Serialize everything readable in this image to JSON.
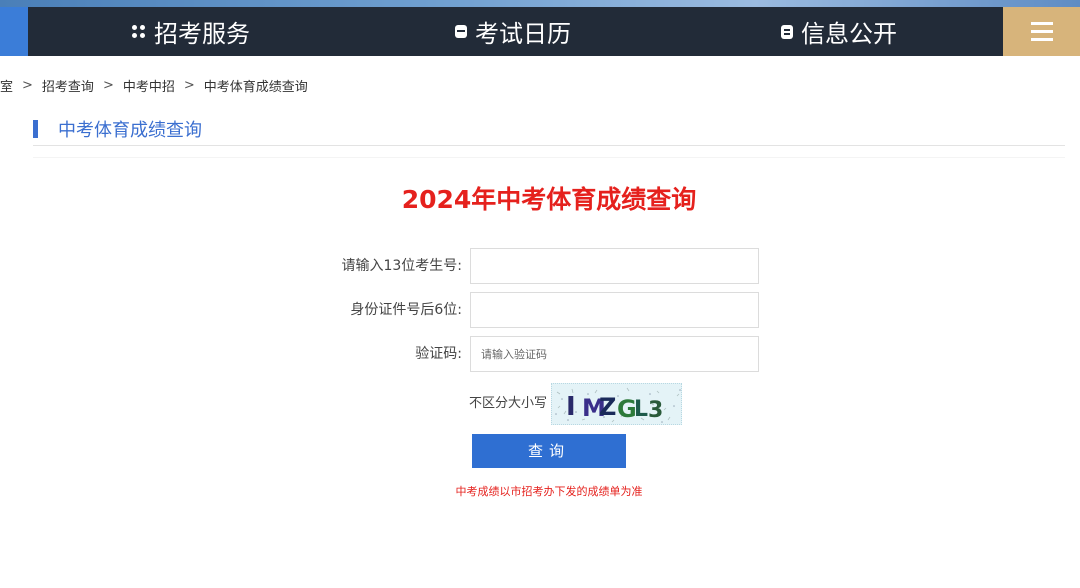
{
  "nav": {
    "items": [
      {
        "label": "招考服务",
        "icon": "grid-dots-icon"
      },
      {
        "label": "考试日历",
        "icon": "calendar-icon"
      },
      {
        "label": "信息公开",
        "icon": "document-icon"
      }
    ],
    "menu_icon": "hamburger-menu-icon"
  },
  "breadcrumb": {
    "items": [
      "室",
      "招考查询",
      "中考中招",
      "中考体育成绩查询"
    ],
    "separator": ">"
  },
  "section": {
    "title": "中考体育成绩查询"
  },
  "page": {
    "title": "2024年中考体育成绩查询"
  },
  "form": {
    "candidate_label": "请输入13位考生号:",
    "candidate_value": "",
    "id_label": "身份证件号后6位:",
    "id_value": "",
    "captcha_label": "验证码:",
    "captcha_placeholder": "请输入验证码",
    "captcha_hint": "不区分大小写",
    "captcha_text": "IMZGL3",
    "submit_label": "查询",
    "notice": "中考成绩以市招考办下发的成绩单为准"
  },
  "colors": {
    "nav_bg": "#222b38",
    "accent_blue": "#2f6fd2",
    "title_red": "#e5211d",
    "menu_gold": "#d7b47b"
  }
}
